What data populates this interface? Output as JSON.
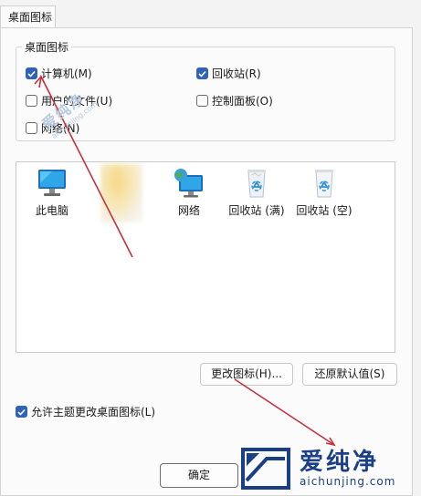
{
  "tab": {
    "label": "桌面图标"
  },
  "group": {
    "title": "桌面图标",
    "checkboxes": [
      {
        "label": "计算机(M)",
        "checked": true
      },
      {
        "label": "回收站(R)",
        "checked": true
      },
      {
        "label": "用户的文件(U)",
        "checked": false
      },
      {
        "label": "控制面板(O)",
        "checked": false
      },
      {
        "label": "网络(N)",
        "checked": false
      }
    ]
  },
  "icons": [
    {
      "label": "此电脑",
      "icon": "monitor-icon"
    },
    {
      "label": "网络",
      "icon": "network-globe-icon"
    },
    {
      "label": "回收站 (满)",
      "icon": "recycle-bin-full-icon"
    },
    {
      "label": "回收站 (空)",
      "icon": "recycle-bin-empty-icon"
    }
  ],
  "buttons": {
    "change_icon": "更改图标(H)...",
    "restore_default": "还原默认值(S)",
    "ok": "确定"
  },
  "allow_theme": {
    "label": "允许主题更改桌面图标(L)",
    "checked": true
  },
  "watermark": {
    "brand": "爱纯净",
    "domain": "aichunjing.com"
  },
  "colors": {
    "accent": "#2f62b8",
    "annotation_arrow": "#c4313a",
    "watermark": "#1b3f86"
  }
}
